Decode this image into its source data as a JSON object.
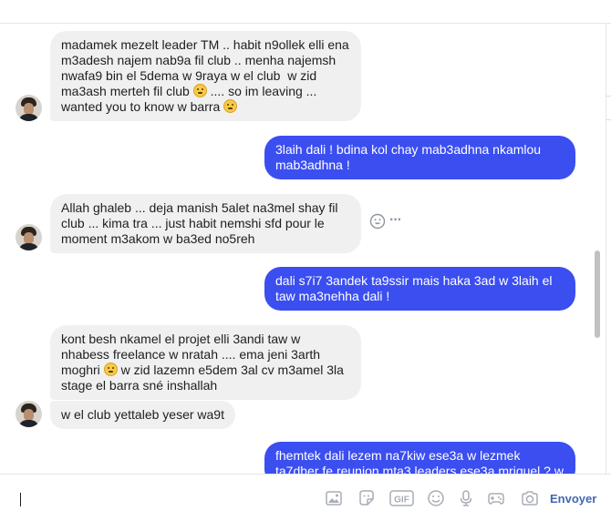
{
  "messages": [
    {
      "side": "in",
      "text_a": "madamek mezelt leader TM .. habit n9ollek elli ena m3adesh najem nab9a fil club .. menha najemsh nwafa9 bin el 5dema w 9raya w el club  w zid ma3ash merteh fil club ",
      "text_b": " .... so im leaving ... wanted you to know w barra ",
      "emoji_1": "frowning-face",
      "emoji_2": "grimacing-face"
    },
    {
      "side": "out",
      "text": "3laih dali ! bdina kol chay mab3adhna nkamlou mab3adhna !"
    },
    {
      "side": "in",
      "text": "Allah ghaleb ... deja manish 5alet na3mel shay fil club ... kima tra ... just habit nemshi sfd pour le moment m3akom w ba3ed no5reh"
    },
    {
      "side": "out",
      "text": "dali s7i7 3andek ta9ssir mais haka 3ad w 3laih el taw ma3nehha dali !"
    },
    {
      "side": "in",
      "text_a": "kont besh nkamel el projet elli 3andi taw w nhabess freelance w nratah .... ema jeni 3arth moghri ",
      "text_b": " w zid lazemn e5dem 3al cv m3amel 3la stage el barra sné inshallah",
      "emoji_1": "frowning-face"
    },
    {
      "side": "in",
      "text": "w el club yettaleb yeser wa9t"
    },
    {
      "side": "out",
      "text": "fhemtek dali lezem na7kiw ese3a w lezmek ta7dher fe reunion mta3 leaders ese3a mriquel ? w"
    }
  ],
  "message_actions": {
    "react_icon": "smiley-icon",
    "more_icon": "more-icon",
    "more_label": "···"
  },
  "composer": {
    "send_label": "Envoyer",
    "tools": [
      "image-icon",
      "sticker-icon",
      "gif-icon",
      "emoji-icon",
      "microphone-icon",
      "gamepad-icon",
      "camera-icon"
    ]
  },
  "colors": {
    "outgoing": "#3b4ef0",
    "incoming": "#f1f0f0",
    "send": "#4267b2"
  }
}
